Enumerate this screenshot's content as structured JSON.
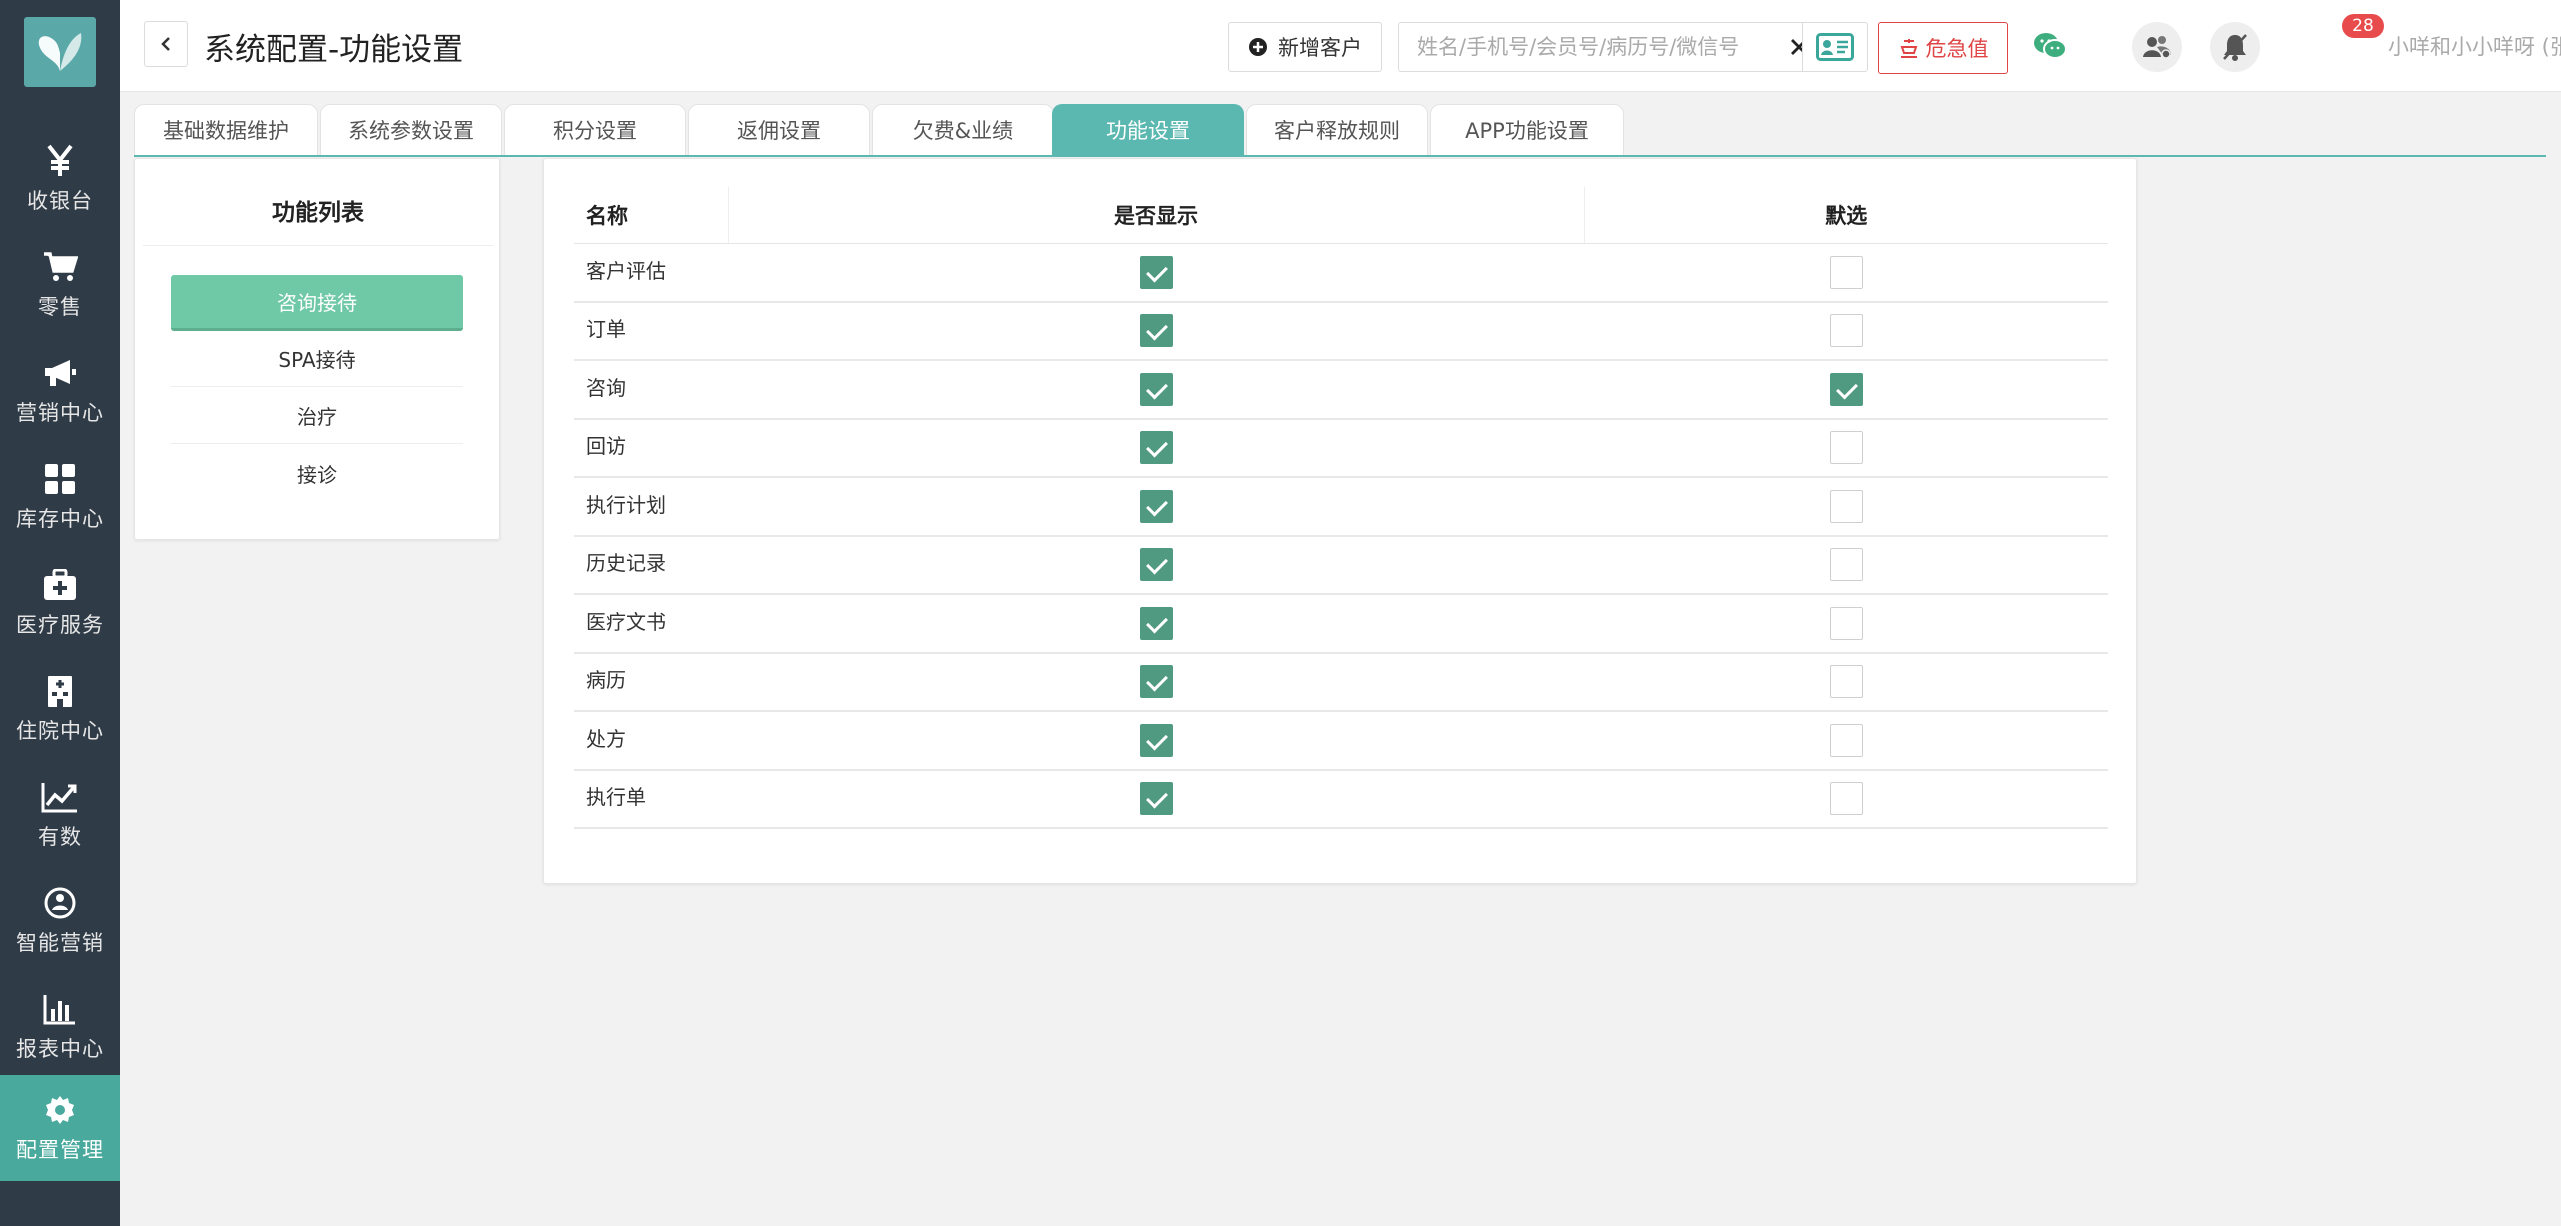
{
  "sidebar": {
    "items": [
      {
        "label": "收银台",
        "icon": "yen-icon",
        "active": false
      },
      {
        "label": "零售",
        "icon": "cart-icon",
        "active": false
      },
      {
        "label": "营销中心",
        "icon": "megaphone-icon",
        "active": false
      },
      {
        "label": "库存中心",
        "icon": "grid-icon",
        "active": false
      },
      {
        "label": "医疗服务",
        "icon": "medical-kit-icon",
        "active": false
      },
      {
        "label": "住院中心",
        "icon": "hospital-icon",
        "active": false
      },
      {
        "label": "有数",
        "icon": "trend-chart-icon",
        "active": false
      },
      {
        "label": "智能营销",
        "icon": "smart-marketing-icon",
        "active": false
      },
      {
        "label": "报表中心",
        "icon": "bar-chart-icon",
        "active": false
      },
      {
        "label": "配置管理",
        "icon": "gear-icon",
        "active": true
      }
    ]
  },
  "header": {
    "title": "系统配置-功能设置",
    "add_customer_label": "新增客户",
    "search_placeholder": "姓名/手机号/会员号/病历号/微信号",
    "danger_label": "危急值",
    "notification_count": "28",
    "user_name": "小咩和小小咩呀 (张江门诊部)"
  },
  "tabs": [
    {
      "label": "基础数据维护",
      "active": false
    },
    {
      "label": "系统参数设置",
      "active": false
    },
    {
      "label": "积分设置",
      "active": false
    },
    {
      "label": "返佣设置",
      "active": false
    },
    {
      "label": "欠费&业绩",
      "active": false
    },
    {
      "label": "功能设置",
      "active": true
    },
    {
      "label": "客户释放规则",
      "active": false
    },
    {
      "label": "APP功能设置",
      "active": false
    }
  ],
  "func_list": {
    "title": "功能列表",
    "items": [
      {
        "label": "咨询接待",
        "active": true
      },
      {
        "label": "SPA接待",
        "active": false
      },
      {
        "label": "治疗",
        "active": false
      },
      {
        "label": "接诊",
        "active": false
      }
    ]
  },
  "table": {
    "headers": {
      "name": "名称",
      "show": "是否显示",
      "default": "默选"
    },
    "rows": [
      {
        "name": "客户评估",
        "show": true,
        "default": false
      },
      {
        "name": "订单",
        "show": true,
        "default": false
      },
      {
        "name": "咨询",
        "show": true,
        "default": true
      },
      {
        "name": "回访",
        "show": true,
        "default": false
      },
      {
        "name": "执行计划",
        "show": true,
        "default": false
      },
      {
        "name": "历史记录",
        "show": true,
        "default": false
      },
      {
        "name": "医疗文书",
        "show": true,
        "default": false
      },
      {
        "name": "病历",
        "show": true,
        "default": false
      },
      {
        "name": "处方",
        "show": true,
        "default": false
      },
      {
        "name": "执行单",
        "show": true,
        "default": false
      }
    ]
  },
  "colors": {
    "sidebar_bg": "#2f3b47",
    "accent": "#5bb8b0",
    "checkbox_checked": "#4f9a80",
    "func_active": "#6fc8a6",
    "danger": "#e04545"
  }
}
